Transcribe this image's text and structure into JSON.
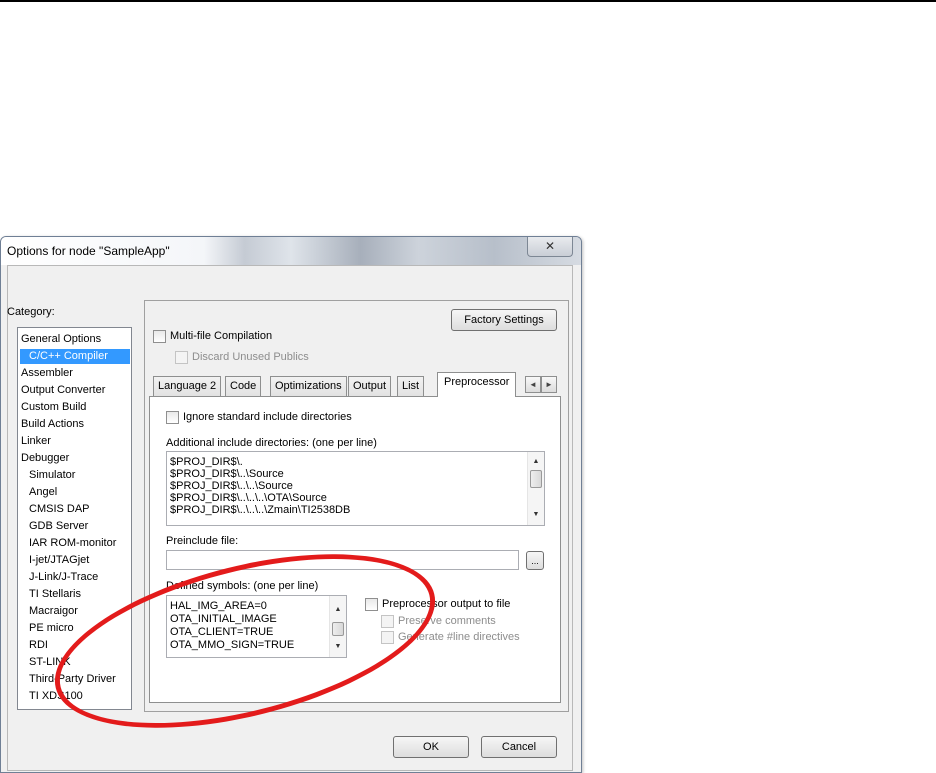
{
  "dialog": {
    "title": "Options for node \"SampleApp\"",
    "close_glyph": "✕"
  },
  "category": {
    "label": "Category:",
    "items": [
      {
        "label": "General Options",
        "indent": false,
        "selected": false
      },
      {
        "label": "C/C++ Compiler",
        "indent": false,
        "selected": true
      },
      {
        "label": "Assembler",
        "indent": false,
        "selected": false
      },
      {
        "label": "Output Converter",
        "indent": false,
        "selected": false
      },
      {
        "label": "Custom Build",
        "indent": false,
        "selected": false
      },
      {
        "label": "Build Actions",
        "indent": false,
        "selected": false
      },
      {
        "label": "Linker",
        "indent": false,
        "selected": false
      },
      {
        "label": "Debugger",
        "indent": false,
        "selected": false
      },
      {
        "label": "Simulator",
        "indent": true,
        "selected": false
      },
      {
        "label": "Angel",
        "indent": true,
        "selected": false
      },
      {
        "label": "CMSIS DAP",
        "indent": true,
        "selected": false
      },
      {
        "label": "GDB Server",
        "indent": true,
        "selected": false
      },
      {
        "label": "IAR ROM-monitor",
        "indent": true,
        "selected": false
      },
      {
        "label": "I-jet/JTAGjet",
        "indent": true,
        "selected": false
      },
      {
        "label": "J-Link/J-Trace",
        "indent": true,
        "selected": false
      },
      {
        "label": "TI Stellaris",
        "indent": true,
        "selected": false
      },
      {
        "label": "Macraigor",
        "indent": true,
        "selected": false
      },
      {
        "label": "PE micro",
        "indent": true,
        "selected": false
      },
      {
        "label": "RDI",
        "indent": true,
        "selected": false
      },
      {
        "label": "ST-LINK",
        "indent": true,
        "selected": false
      },
      {
        "label": "Third-Party Driver",
        "indent": true,
        "selected": false
      },
      {
        "label": "TI XDS100",
        "indent": true,
        "selected": false
      }
    ]
  },
  "panel": {
    "factory_settings": "Factory Settings",
    "multi_file": "Multi-file Compilation",
    "discard_unused": "Discard Unused Publics",
    "tabs": [
      "Language 2",
      "Code",
      "Optimizations",
      "Output",
      "List",
      "Preprocessor"
    ],
    "active_tab": "Preprocessor",
    "scroll_left": "◄",
    "scroll_right": "►"
  },
  "preprocessor": {
    "ignore_std": "Ignore standard include directories",
    "include_label": "Additional include directories: (one per line)",
    "include_dirs": [
      "$PROJ_DIR$\\.",
      "$PROJ_DIR$\\..\\Source",
      "$PROJ_DIR$\\..\\..\\Source",
      "$PROJ_DIR$\\..\\..\\..\\OTA\\Source",
      "$PROJ_DIR$\\..\\..\\..\\Zmain\\TI2538DB"
    ],
    "preinclude_label": "Preinclude file:",
    "preinclude_value": "",
    "browse": "...",
    "defined_label": "Defined symbols: (one per line)",
    "defined_symbols": [
      "HAL_IMG_AREA=0",
      "OTA_INITIAL_IMAGE",
      "OTA_CLIENT=TRUE",
      "OTA_MMO_SIGN=TRUE"
    ],
    "output_to_file": "Preprocessor output to file",
    "preserve_comments": "Preserve comments",
    "generate_line": "Generate #line directives"
  },
  "footer": {
    "ok": "OK",
    "cancel": "Cancel"
  },
  "annotation": {
    "color": "#e31b1b"
  }
}
